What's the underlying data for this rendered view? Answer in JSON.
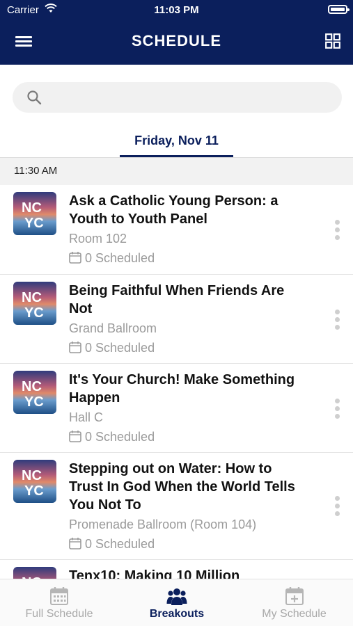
{
  "status_bar": {
    "carrier": "Carrier",
    "time": "11:03 PM"
  },
  "header": {
    "title": "SCHEDULE"
  },
  "search": {
    "placeholder": ""
  },
  "date_tab": {
    "label": "Friday, Nov 11"
  },
  "time_group": {
    "label": "11:30 AM"
  },
  "thumbnail_text": {
    "line1": "NC",
    "line2": "YC"
  },
  "sessions": [
    {
      "title_line1": "Ask a Catholic Young Person: a",
      "title_line2": "Youth to Youth Panel",
      "title_line3": "",
      "room": "Room 102",
      "scheduled": "0 Scheduled"
    },
    {
      "title_line1": "Being Faithful When Friends Are",
      "title_line2": "Not",
      "title_line3": "",
      "room": "Grand Ballroom",
      "scheduled": "0 Scheduled"
    },
    {
      "title_line1": "It's Your Church! Make Something",
      "title_line2": "Happen",
      "title_line3": "",
      "room": "Hall C",
      "scheduled": "0 Scheduled"
    },
    {
      "title_line1": "Stepping out on Water: How to",
      "title_line2": "Trust In God When the World Tells",
      "title_line3": "You Not To",
      "room": "Promenade Ballroom (Room 104)",
      "scheduled": "0 Scheduled"
    },
    {
      "title_line1": "Tenx10: Making 10 Million",
      "title_line2": "",
      "title_line3": "",
      "room": "",
      "scheduled": ""
    }
  ],
  "tabbar": {
    "tabs": [
      {
        "label": "Full Schedule",
        "icon": "calendar-icon",
        "active": false
      },
      {
        "label": "Breakouts",
        "icon": "people-icon",
        "active": true
      },
      {
        "label": "My Schedule",
        "icon": "calendar-plus-icon",
        "active": false
      }
    ]
  },
  "colors": {
    "brand": "#0b1f5c",
    "muted": "#9a9a9a",
    "divider": "#e4e4e4"
  }
}
